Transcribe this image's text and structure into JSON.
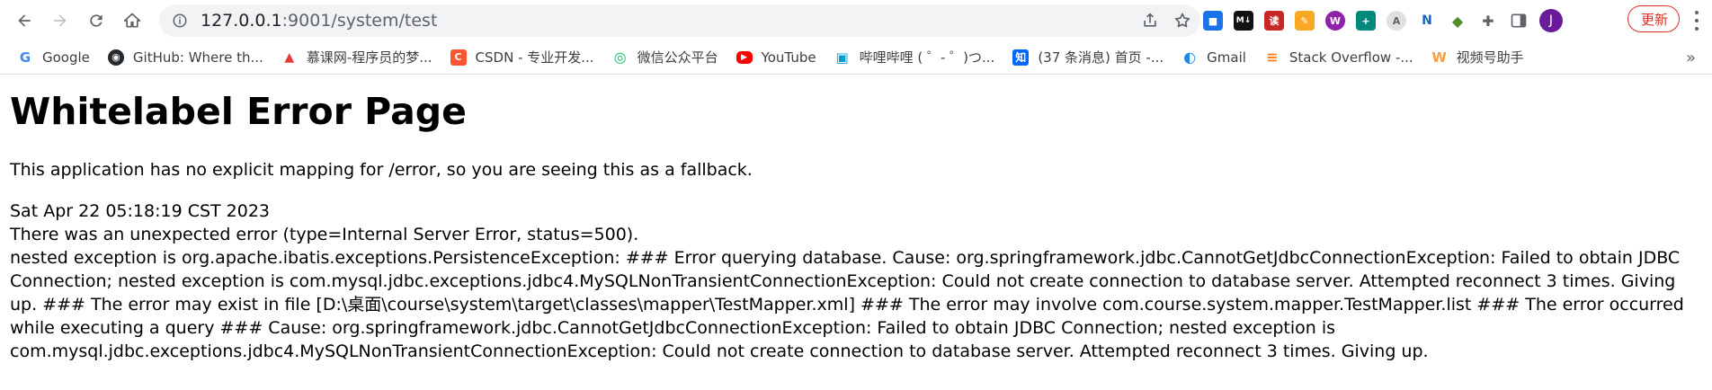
{
  "browser": {
    "url_host": "127.0.0.1",
    "url_rest": ":9001/system/test",
    "update_label": "更新",
    "avatar_letter": "J"
  },
  "extensions": [
    {
      "name": "ext-blue-square",
      "color": "#1a73e8",
      "glyph": "■"
    },
    {
      "name": "ext-markdown",
      "color": "#111111",
      "glyph": "M↓"
    },
    {
      "name": "ext-red-du",
      "color": "#c62828",
      "glyph": "读"
    },
    {
      "name": "ext-notes",
      "color": "#f9a825",
      "glyph": "✎"
    },
    {
      "name": "ext-purple-w",
      "color": "#8e24aa",
      "glyph": "W"
    },
    {
      "name": "ext-green-plus",
      "color": "#00897b",
      "glyph": "+"
    },
    {
      "name": "ext-grey-a",
      "color": "#9e9e9e",
      "glyph": "A"
    },
    {
      "name": "ext-blue-n",
      "color": "#1565c0",
      "glyph": "N"
    },
    {
      "name": "ext-shield",
      "color": "#558b2f",
      "glyph": "◆"
    }
  ],
  "bookmarks": [
    {
      "label": "Google",
      "color": "#4285f4",
      "glyph": "G"
    },
    {
      "label": "GitHub: Where th...",
      "color": "#24292e",
      "glyph": "◉"
    },
    {
      "label": "慕课网-程序员的梦...",
      "color": "#e53935",
      "glyph": "▲"
    },
    {
      "label": "CSDN - 专业开发...",
      "color": "#fc5531",
      "glyph": "C"
    },
    {
      "label": "微信公众平台",
      "color": "#07c160",
      "glyph": "◎"
    },
    {
      "label": "YouTube",
      "color": "#ff0000",
      "glyph": "▶"
    },
    {
      "label": "哔哩哔哩 ( ゜- ゜)つ...",
      "color": "#00a1d6",
      "glyph": "▣"
    },
    {
      "label": "(37 条消息) 首页 -...",
      "color": "#0066ff",
      "glyph": "知"
    },
    {
      "label": "Gmail",
      "color": "#1e88e5",
      "glyph": "◐"
    },
    {
      "label": "Stack Overflow -...",
      "color": "#f48024",
      "glyph": "≡"
    },
    {
      "label": "视频号助手",
      "color": "#fa9d3b",
      "glyph": "W"
    }
  ],
  "page": {
    "title": "Whitelabel Error Page",
    "fallback": "This application has no explicit mapping for /error, so you are seeing this as a fallback.",
    "timestamp": "Sat Apr 22 05:18:19 CST 2023",
    "error_line": "There was an unexpected error (type=Internal Server Error, status=500).",
    "detail": "nested exception is org.apache.ibatis.exceptions.PersistenceException: ### Error querying database. Cause: org.springframework.jdbc.CannotGetJdbcConnectionException: Failed to obtain JDBC Connection; nested exception is com.mysql.jdbc.exceptions.jdbc4.MySQLNonTransientConnectionException: Could not create connection to database server. Attempted reconnect 3 times. Giving up. ### The error may exist in file [D:\\桌面\\course\\system\\target\\classes\\mapper\\TestMapper.xml] ### The error may involve com.course.system.mapper.TestMapper.list ### The error occurred while executing a query ### Cause: org.springframework.jdbc.CannotGetJdbcConnectionException: Failed to obtain JDBC Connection; nested exception is com.mysql.jdbc.exceptions.jdbc4.MySQLNonTransientConnectionException: Could not create connection to database server. Attempted reconnect 3 times. Giving up."
  }
}
